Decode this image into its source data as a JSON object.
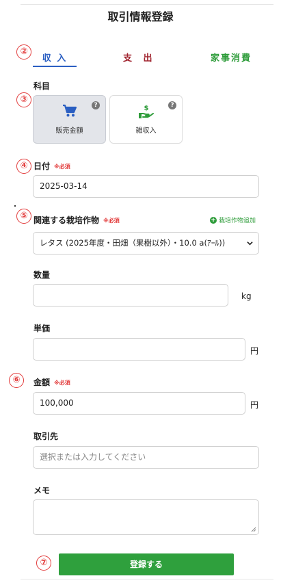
{
  "page": {
    "title": "取引情報登録"
  },
  "markers": [
    "②",
    "③",
    "④",
    "⑤",
    "⑥",
    "⑦"
  ],
  "tabs": [
    {
      "label": "収 入",
      "color": "#2b5fc2",
      "active": true
    },
    {
      "label": "支 出",
      "color": "#a0222d",
      "active": false
    },
    {
      "label": "家事消費",
      "color": "#2e9c3a",
      "active": false
    }
  ],
  "category": {
    "label": "科目",
    "options": [
      {
        "label": "販売金額",
        "icon": "cart-icon",
        "selected": true,
        "help": "?"
      },
      {
        "label": "雑収入",
        "icon": "hand-money-icon",
        "selected": false,
        "help": "?"
      }
    ]
  },
  "date": {
    "label": "日付",
    "required": "※必須",
    "value": "2025-03-14"
  },
  "crop": {
    "label": "関連する栽培作物",
    "required": "※必須",
    "add_label": "栽培作物追加",
    "add_icon": "plus-circle-icon",
    "selected": "レタス (2025年度・田畑（果樹以外）・10.0 a(ｱｰﾙ))"
  },
  "quantity": {
    "label": "数量",
    "value": "",
    "unit": "kg"
  },
  "unit_price": {
    "label": "単価",
    "value": "",
    "unit": "円"
  },
  "amount": {
    "label": "金額",
    "required": "※必須",
    "value": "100,000",
    "unit": "円"
  },
  "partner": {
    "label": "取引先",
    "placeholder": "選択または入力してください"
  },
  "memo": {
    "label": "メモ",
    "value": ""
  },
  "submit": {
    "label": "登録する",
    "color": "#2fa03d"
  }
}
